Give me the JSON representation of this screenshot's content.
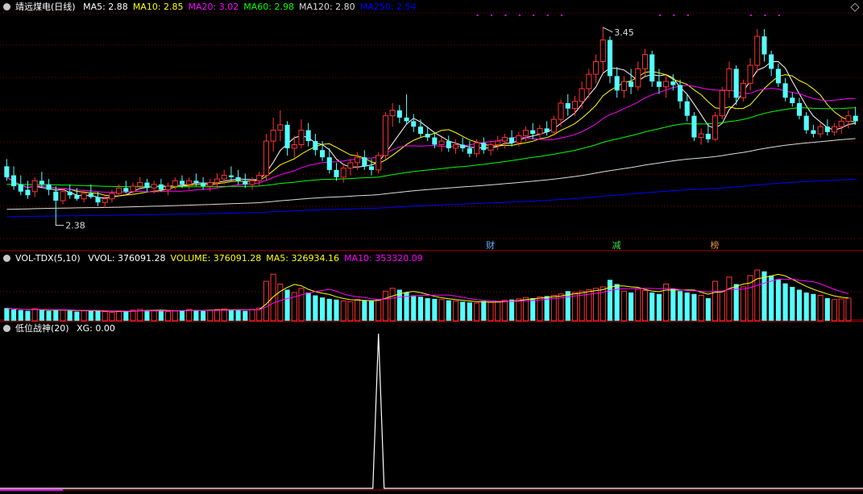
{
  "header": {
    "title": "靖远煤电(日线)",
    "ma_labels": [
      {
        "text": "MA5: 2.88",
        "color": "#ffffff"
      },
      {
        "text": "MA10: 2.85",
        "color": "#ffff00"
      },
      {
        "text": "MA20: 3.02",
        "color": "#ff00ff"
      },
      {
        "text": "MA60: 2.98",
        "color": "#00ff00"
      },
      {
        "text": "MA120: 2.80",
        "color": "#dcdcdc"
      },
      {
        "text": "MA250: 2.54",
        "color": "#0000ff"
      }
    ]
  },
  "vol_header": {
    "title": "VOL-TDX(5,10)",
    "labels": [
      {
        "text": "VVOL: 376091.28",
        "color": "#ffffff"
      },
      {
        "text": "VOLUME: 376091.28",
        "color": "#ffff00"
      },
      {
        "text": "MA5: 326934.16",
        "color": "#ffff00"
      },
      {
        "text": "MA10: 353320.09",
        "color": "#ff00ff"
      }
    ]
  },
  "ind_header": {
    "title": "低位战神(20)",
    "labels": [
      {
        "text": "XG: 0.00",
        "color": "#ffffff"
      }
    ]
  },
  "colors": {
    "up": "#ff3232",
    "down": "#54ffff",
    "ma5": "#ffffff",
    "ma10": "#ffff00",
    "ma20": "#ff00ff",
    "ma60": "#00ff00",
    "ma120": "#dcdcdc",
    "ma250": "#0000ff",
    "grid": "#8b0000",
    "frame": "#aa0000",
    "event_dot": "#ff00ff"
  },
  "chart_data": [
    {
      "type": "candlestick",
      "y_range": [
        2.28,
        3.53
      ],
      "max_marker": {
        "index": 85,
        "value": 3.45,
        "label": "3.45"
      },
      "min_marker": {
        "index": 7,
        "value": 2.38,
        "label": "2.38"
      },
      "events": [
        {
          "index": 69,
          "label": "财",
          "color": "#5ab4ff"
        },
        {
          "index": 87,
          "label": "减",
          "color": "#3fdc3f"
        },
        {
          "index": 101,
          "label": "榜",
          "color": "#e0903c"
        }
      ],
      "event_dot_ranges": [
        [
          67,
          80
        ],
        [
          93,
          98
        ],
        [
          106,
          110
        ]
      ],
      "candles": [
        {
          "o": 2.68,
          "h": 2.72,
          "l": 2.6,
          "c": 2.62
        },
        {
          "o": 2.63,
          "h": 2.68,
          "l": 2.55,
          "c": 2.57
        },
        {
          "o": 2.58,
          "h": 2.63,
          "l": 2.52,
          "c": 2.54
        },
        {
          "o": 2.55,
          "h": 2.6,
          "l": 2.5,
          "c": 2.52
        },
        {
          "o": 2.54,
          "h": 2.62,
          "l": 2.51,
          "c": 2.6
        },
        {
          "o": 2.6,
          "h": 2.65,
          "l": 2.56,
          "c": 2.58
        },
        {
          "o": 2.58,
          "h": 2.61,
          "l": 2.52,
          "c": 2.55
        },
        {
          "o": 2.54,
          "h": 2.57,
          "l": 2.38,
          "c": 2.49
        },
        {
          "o": 2.49,
          "h": 2.56,
          "l": 2.47,
          "c": 2.54
        },
        {
          "o": 2.54,
          "h": 2.58,
          "l": 2.5,
          "c": 2.52
        },
        {
          "o": 2.52,
          "h": 2.56,
          "l": 2.49,
          "c": 2.5
        },
        {
          "o": 2.5,
          "h": 2.55,
          "l": 2.48,
          "c": 2.53
        },
        {
          "o": 2.53,
          "h": 2.58,
          "l": 2.5,
          "c": 2.51
        },
        {
          "o": 2.51,
          "h": 2.54,
          "l": 2.46,
          "c": 2.48
        },
        {
          "o": 2.48,
          "h": 2.52,
          "l": 2.45,
          "c": 2.5
        },
        {
          "o": 2.5,
          "h": 2.55,
          "l": 2.48,
          "c": 2.53
        },
        {
          "o": 2.53,
          "h": 2.58,
          "l": 2.51,
          "c": 2.56
        },
        {
          "o": 2.56,
          "h": 2.6,
          "l": 2.53,
          "c": 2.54
        },
        {
          "o": 2.54,
          "h": 2.59,
          "l": 2.52,
          "c": 2.57
        },
        {
          "o": 2.57,
          "h": 2.62,
          "l": 2.55,
          "c": 2.59
        },
        {
          "o": 2.59,
          "h": 2.61,
          "l": 2.54,
          "c": 2.56
        },
        {
          "o": 2.56,
          "h": 2.6,
          "l": 2.53,
          "c": 2.58
        },
        {
          "o": 2.58,
          "h": 2.61,
          "l": 2.54,
          "c": 2.55
        },
        {
          "o": 2.55,
          "h": 2.59,
          "l": 2.52,
          "c": 2.57
        },
        {
          "o": 2.57,
          "h": 2.62,
          "l": 2.55,
          "c": 2.6
        },
        {
          "o": 2.6,
          "h": 2.63,
          "l": 2.56,
          "c": 2.58
        },
        {
          "o": 2.58,
          "h": 2.62,
          "l": 2.55,
          "c": 2.6
        },
        {
          "o": 2.6,
          "h": 2.64,
          "l": 2.57,
          "c": 2.59
        },
        {
          "o": 2.59,
          "h": 2.62,
          "l": 2.55,
          "c": 2.57
        },
        {
          "o": 2.57,
          "h": 2.61,
          "l": 2.54,
          "c": 2.59
        },
        {
          "o": 2.59,
          "h": 2.64,
          "l": 2.56,
          "c": 2.61
        },
        {
          "o": 2.61,
          "h": 2.66,
          "l": 2.58,
          "c": 2.63
        },
        {
          "o": 2.63,
          "h": 2.68,
          "l": 2.6,
          "c": 2.62
        },
        {
          "o": 2.62,
          "h": 2.66,
          "l": 2.58,
          "c": 2.6
        },
        {
          "o": 2.6,
          "h": 2.64,
          "l": 2.56,
          "c": 2.58
        },
        {
          "o": 2.58,
          "h": 2.62,
          "l": 2.55,
          "c": 2.6
        },
        {
          "o": 2.6,
          "h": 2.65,
          "l": 2.57,
          "c": 2.63
        },
        {
          "o": 2.63,
          "h": 2.86,
          "l": 2.6,
          "c": 2.82
        },
        {
          "o": 2.82,
          "h": 2.95,
          "l": 2.76,
          "c": 2.88
        },
        {
          "o": 2.88,
          "h": 2.99,
          "l": 2.82,
          "c": 2.91
        },
        {
          "o": 2.91,
          "h": 2.93,
          "l": 2.74,
          "c": 2.78
        },
        {
          "o": 2.78,
          "h": 2.85,
          "l": 2.73,
          "c": 2.8
        },
        {
          "o": 2.8,
          "h": 2.94,
          "l": 2.78,
          "c": 2.88
        },
        {
          "o": 2.88,
          "h": 2.92,
          "l": 2.79,
          "c": 2.82
        },
        {
          "o": 2.82,
          "h": 2.86,
          "l": 2.74,
          "c": 2.77
        },
        {
          "o": 2.77,
          "h": 2.82,
          "l": 2.71,
          "c": 2.73
        },
        {
          "o": 2.73,
          "h": 2.78,
          "l": 2.64,
          "c": 2.66
        },
        {
          "o": 2.66,
          "h": 2.7,
          "l": 2.6,
          "c": 2.62
        },
        {
          "o": 2.62,
          "h": 2.69,
          "l": 2.59,
          "c": 2.67
        },
        {
          "o": 2.67,
          "h": 2.72,
          "l": 2.63,
          "c": 2.7
        },
        {
          "o": 2.7,
          "h": 2.76,
          "l": 2.66,
          "c": 2.73
        },
        {
          "o": 2.73,
          "h": 2.77,
          "l": 2.66,
          "c": 2.68
        },
        {
          "o": 2.68,
          "h": 2.72,
          "l": 2.63,
          "c": 2.66
        },
        {
          "o": 2.66,
          "h": 2.76,
          "l": 2.64,
          "c": 2.74
        },
        {
          "o": 2.74,
          "h": 2.98,
          "l": 2.72,
          "c": 2.96
        },
        {
          "o": 2.96,
          "h": 3.03,
          "l": 2.9,
          "c": 2.99
        },
        {
          "o": 2.99,
          "h": 3.02,
          "l": 2.92,
          "c": 2.95
        },
        {
          "o": 2.95,
          "h": 3.08,
          "l": 2.91,
          "c": 2.93
        },
        {
          "o": 2.93,
          "h": 2.97,
          "l": 2.87,
          "c": 2.9
        },
        {
          "o": 2.9,
          "h": 2.94,
          "l": 2.84,
          "c": 2.86
        },
        {
          "o": 2.86,
          "h": 2.9,
          "l": 2.82,
          "c": 2.84
        },
        {
          "o": 2.84,
          "h": 2.87,
          "l": 2.78,
          "c": 2.8
        },
        {
          "o": 2.8,
          "h": 2.84,
          "l": 2.76,
          "c": 2.82
        },
        {
          "o": 2.82,
          "h": 2.85,
          "l": 2.76,
          "c": 2.78
        },
        {
          "o": 2.78,
          "h": 2.83,
          "l": 2.75,
          "c": 2.8
        },
        {
          "o": 2.8,
          "h": 2.84,
          "l": 2.76,
          "c": 2.78
        },
        {
          "o": 2.78,
          "h": 2.82,
          "l": 2.73,
          "c": 2.75
        },
        {
          "o": 2.75,
          "h": 2.83,
          "l": 2.73,
          "c": 2.81
        },
        {
          "o": 2.81,
          "h": 2.84,
          "l": 2.75,
          "c": 2.77
        },
        {
          "o": 2.77,
          "h": 2.82,
          "l": 2.74,
          "c": 2.8
        },
        {
          "o": 2.8,
          "h": 2.85,
          "l": 2.77,
          "c": 2.82
        },
        {
          "o": 2.82,
          "h": 2.86,
          "l": 2.78,
          "c": 2.84
        },
        {
          "o": 2.84,
          "h": 2.88,
          "l": 2.79,
          "c": 2.81
        },
        {
          "o": 2.81,
          "h": 2.87,
          "l": 2.79,
          "c": 2.85
        },
        {
          "o": 2.85,
          "h": 2.9,
          "l": 2.82,
          "c": 2.88
        },
        {
          "o": 2.88,
          "h": 2.92,
          "l": 2.83,
          "c": 2.86
        },
        {
          "o": 2.86,
          "h": 2.91,
          "l": 2.84,
          "c": 2.89
        },
        {
          "o": 2.89,
          "h": 2.93,
          "l": 2.85,
          "c": 2.87
        },
        {
          "o": 2.87,
          "h": 2.96,
          "l": 2.85,
          "c": 2.94
        },
        {
          "o": 2.94,
          "h": 3.05,
          "l": 2.9,
          "c": 3.03
        },
        {
          "o": 3.03,
          "h": 3.08,
          "l": 2.96,
          "c": 3.0
        },
        {
          "o": 3.0,
          "h": 3.07,
          "l": 2.96,
          "c": 3.04
        },
        {
          "o": 3.04,
          "h": 3.15,
          "l": 3.0,
          "c": 3.11
        },
        {
          "o": 3.11,
          "h": 3.22,
          "l": 3.06,
          "c": 3.19
        },
        {
          "o": 3.19,
          "h": 3.3,
          "l": 3.14,
          "c": 3.26
        },
        {
          "o": 3.26,
          "h": 3.45,
          "l": 3.2,
          "c": 3.38
        },
        {
          "o": 3.38,
          "h": 3.4,
          "l": 3.14,
          "c": 3.18
        },
        {
          "o": 3.18,
          "h": 3.23,
          "l": 3.06,
          "c": 3.1
        },
        {
          "o": 3.1,
          "h": 3.18,
          "l": 3.06,
          "c": 3.15
        },
        {
          "o": 3.15,
          "h": 3.22,
          "l": 3.08,
          "c": 3.12
        },
        {
          "o": 3.12,
          "h": 3.26,
          "l": 3.1,
          "c": 3.22
        },
        {
          "o": 3.22,
          "h": 3.33,
          "l": 3.18,
          "c": 3.3
        },
        {
          "o": 3.3,
          "h": 3.32,
          "l": 3.12,
          "c": 3.15
        },
        {
          "o": 3.15,
          "h": 3.22,
          "l": 3.08,
          "c": 3.12
        },
        {
          "o": 3.12,
          "h": 3.18,
          "l": 3.06,
          "c": 3.15
        },
        {
          "o": 3.15,
          "h": 3.19,
          "l": 3.1,
          "c": 3.13
        },
        {
          "o": 3.13,
          "h": 3.16,
          "l": 3.0,
          "c": 3.04
        },
        {
          "o": 3.04,
          "h": 3.08,
          "l": 2.93,
          "c": 2.96
        },
        {
          "o": 2.96,
          "h": 2.98,
          "l": 2.82,
          "c": 2.84
        },
        {
          "o": 2.84,
          "h": 2.89,
          "l": 2.8,
          "c": 2.86
        },
        {
          "o": 2.86,
          "h": 2.92,
          "l": 2.81,
          "c": 2.83
        },
        {
          "o": 2.83,
          "h": 2.98,
          "l": 2.82,
          "c": 2.96
        },
        {
          "o": 2.96,
          "h": 3.12,
          "l": 2.94,
          "c": 3.1
        },
        {
          "o": 3.1,
          "h": 3.26,
          "l": 3.06,
          "c": 3.22
        },
        {
          "o": 3.22,
          "h": 3.24,
          "l": 3.02,
          "c": 3.06
        },
        {
          "o": 3.06,
          "h": 3.16,
          "l": 3.04,
          "c": 3.14
        },
        {
          "o": 3.14,
          "h": 3.28,
          "l": 3.1,
          "c": 3.24
        },
        {
          "o": 3.24,
          "h": 3.44,
          "l": 3.2,
          "c": 3.4
        },
        {
          "o": 3.4,
          "h": 3.44,
          "l": 3.26,
          "c": 3.3
        },
        {
          "o": 3.3,
          "h": 3.32,
          "l": 3.18,
          "c": 3.22
        },
        {
          "o": 3.22,
          "h": 3.25,
          "l": 3.12,
          "c": 3.14
        },
        {
          "o": 3.14,
          "h": 3.17,
          "l": 3.04,
          "c": 3.06
        },
        {
          "o": 3.06,
          "h": 3.09,
          "l": 3.01,
          "c": 3.03
        },
        {
          "o": 3.03,
          "h": 3.06,
          "l": 2.94,
          "c": 2.96
        },
        {
          "o": 2.96,
          "h": 2.98,
          "l": 2.86,
          "c": 2.88
        },
        {
          "o": 2.88,
          "h": 2.91,
          "l": 2.84,
          "c": 2.86
        },
        {
          "o": 2.86,
          "h": 2.92,
          "l": 2.84,
          "c": 2.9
        },
        {
          "o": 2.9,
          "h": 2.94,
          "l": 2.85,
          "c": 2.87
        },
        {
          "o": 2.87,
          "h": 2.92,
          "l": 2.85,
          "c": 2.9
        },
        {
          "o": 2.9,
          "h": 2.96,
          "l": 2.86,
          "c": 2.93
        },
        {
          "o": 2.93,
          "h": 2.99,
          "l": 2.89,
          "c": 2.96
        },
        {
          "o": 2.96,
          "h": 3.01,
          "l": 2.91,
          "c": 2.93
        }
      ]
    },
    {
      "type": "bar",
      "y_range": [
        0,
        800000
      ],
      "volumes": [
        180,
        160,
        150,
        140,
        170,
        150,
        140,
        160,
        150,
        140,
        130,
        140,
        150,
        140,
        130,
        120,
        130,
        140,
        150,
        160,
        150,
        140,
        150,
        130,
        140,
        150,
        160,
        150,
        140,
        150,
        160,
        170,
        160,
        150,
        140,
        160,
        180,
        560,
        660,
        520,
        440,
        400,
        460,
        400,
        360,
        330,
        310,
        300,
        280,
        270,
        300,
        290,
        280,
        300,
        420,
        460,
        440,
        400,
        360,
        340,
        320,
        310,
        300,
        290,
        280,
        270,
        260,
        250,
        280,
        260,
        270,
        290,
        300,
        310,
        330,
        320,
        340,
        350,
        360,
        380,
        420,
        400,
        420,
        440,
        460,
        480,
        580,
        520,
        420,
        400,
        450,
        430,
        400,
        380,
        520,
        460,
        420,
        400,
        380,
        360,
        320,
        560,
        420,
        620,
        520,
        480,
        640,
        720,
        700,
        640,
        590,
        530,
        480,
        440,
        400,
        380,
        360,
        320,
        300,
        310,
        320
      ],
      "volume_unit": 1000,
      "ma5_label": "MA5",
      "ma10_label": "MA10"
    },
    {
      "type": "line",
      "signal_index": 53,
      "signal_value": 1,
      "y_range": [
        0,
        1
      ]
    }
  ]
}
